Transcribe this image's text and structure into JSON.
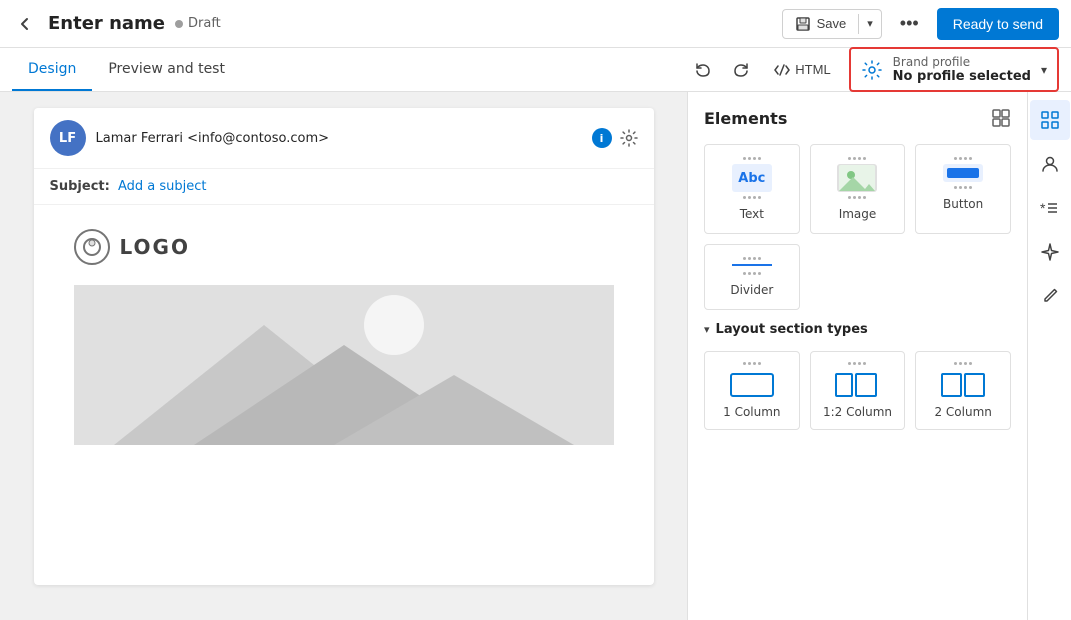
{
  "topbar": {
    "back_label": "←",
    "title": "Enter name",
    "draft_label": "Draft",
    "save_label": "Save",
    "more_label": "•••",
    "ready_label": "Ready to send"
  },
  "subnav": {
    "tabs": [
      {
        "id": "design",
        "label": "Design",
        "active": true
      },
      {
        "id": "preview",
        "label": "Preview and test",
        "active": false
      }
    ],
    "html_label": "HTML",
    "brand_profile": {
      "label": "Brand profile",
      "value": "No profile selected"
    }
  },
  "email": {
    "avatar_initials": "LF",
    "sender_name": "Lamar Ferrari <info@contoso.com>",
    "subject_prefix": "Subject:",
    "subject_placeholder": "Add a subject",
    "logo_text": "LOGO",
    "logo_circle_char": "○"
  },
  "elements_panel": {
    "title": "Elements",
    "items": [
      {
        "id": "text",
        "label": "Text",
        "type": "text"
      },
      {
        "id": "image",
        "label": "Image",
        "type": "image"
      },
      {
        "id": "button",
        "label": "Button",
        "type": "button"
      },
      {
        "id": "divider",
        "label": "Divider",
        "type": "divider"
      }
    ],
    "layout_section_label": "Layout section types",
    "layouts": [
      {
        "id": "1col",
        "label": "1 Column",
        "type": "1col"
      },
      {
        "id": "12col",
        "label": "1:2 Column",
        "type": "12col"
      },
      {
        "id": "2col",
        "label": "2 Column",
        "type": "2col"
      }
    ]
  },
  "right_icons": [
    {
      "id": "elements",
      "icon": "⊞",
      "active": true
    },
    {
      "id": "personalize",
      "icon": "◎",
      "active": false
    },
    {
      "id": "conditions",
      "icon": "*≡",
      "active": false
    },
    {
      "id": "ai",
      "icon": "✦",
      "active": false
    },
    {
      "id": "pencil",
      "icon": "✏",
      "active": false
    }
  ]
}
